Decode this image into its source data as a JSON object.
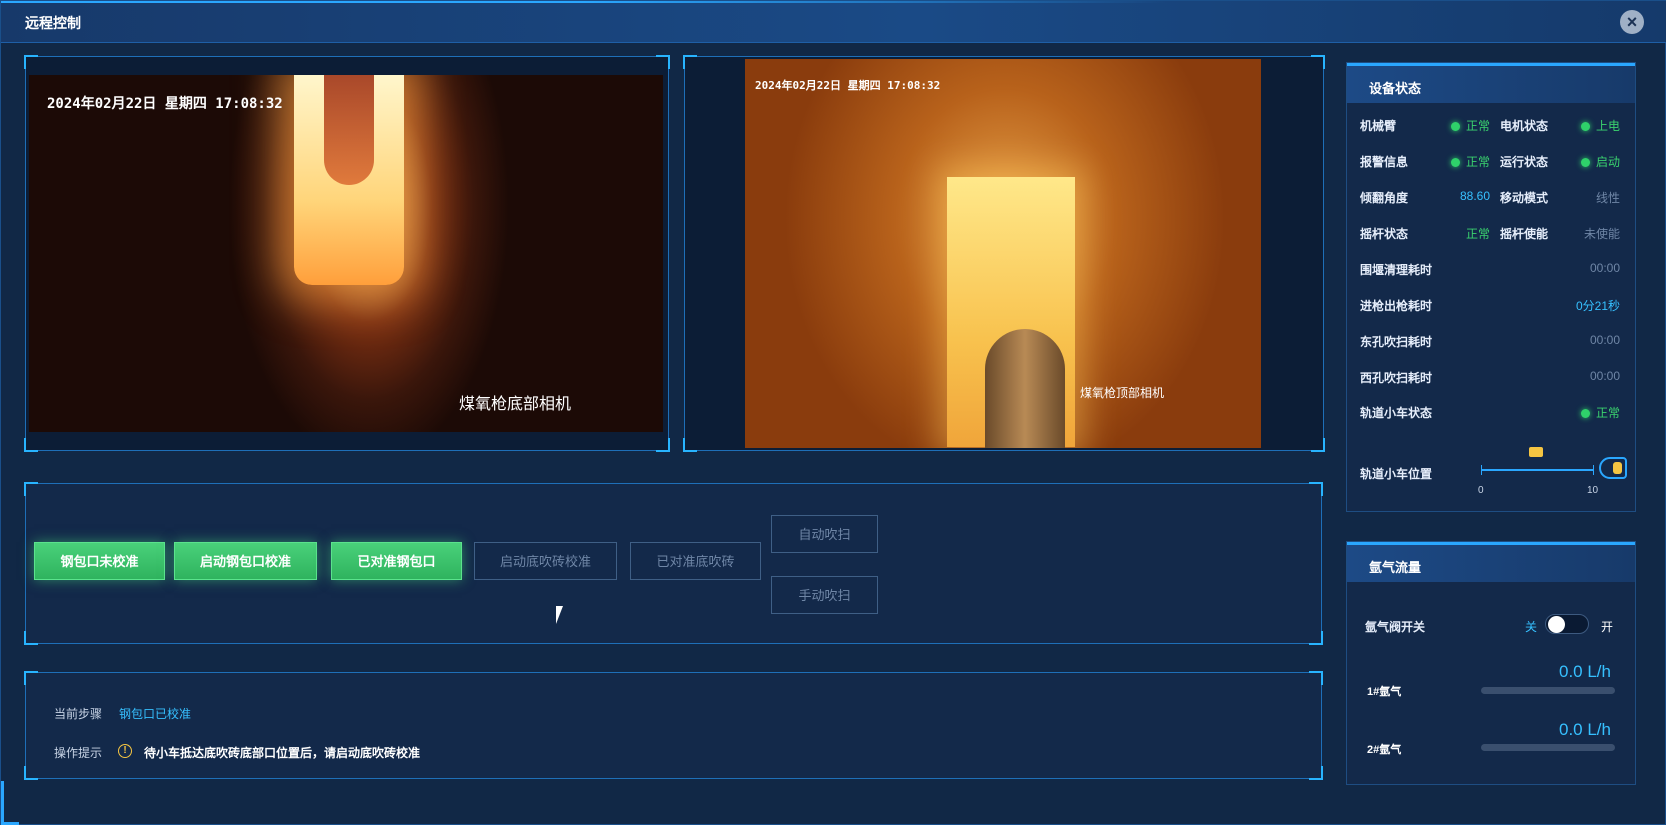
{
  "window": {
    "title": "远程控制",
    "close_icon": "close-icon"
  },
  "cameras": [
    {
      "timestamp": "2024年02月22日  星期四  17:08:32",
      "label": "煤氧枪底部相机"
    },
    {
      "timestamp": "2024年02月22日  星期四  17:08:32",
      "label": "煤氧枪顶部相机"
    }
  ],
  "controls": {
    "buttons": [
      {
        "label": "钢包口未校准",
        "state": "active"
      },
      {
        "label": "启动钢包口校准",
        "state": "active"
      },
      {
        "label": "已对准钢包口",
        "state": "active"
      },
      {
        "label": "启动底吹砖校准",
        "state": "disabled"
      },
      {
        "label": "已对准底吹砖",
        "state": "disabled"
      },
      {
        "label": "自动吹扫",
        "state": "disabled"
      },
      {
        "label": "手动吹扫",
        "state": "disabled"
      }
    ]
  },
  "info": {
    "step_label": "当前步骤",
    "step_value": "钢包口已校准",
    "tip_label": "操作提示",
    "tip_text": "待小车抵达底吹砖底部口位置后，请启动底吹砖校准"
  },
  "device_status": {
    "title": "设备状态",
    "rows": [
      {
        "left_label": "机械臂",
        "left_value": "正常",
        "left_dot": true,
        "right_label": "电机状态",
        "right_value": "上电",
        "right_dot": true
      },
      {
        "left_label": "报警信息",
        "left_value": "正常",
        "left_dot": true,
        "right_label": "运行状态",
        "right_value": "启动",
        "right_dot": true
      },
      {
        "left_label": "倾翻角度",
        "left_value": "88.60",
        "left_dot": false,
        "right_label": "移动模式",
        "right_value": "线性",
        "right_dot": false
      },
      {
        "left_label": "摇杆状态",
        "left_value": "正常",
        "left_dot": false,
        "right_label": "摇杆使能",
        "right_value": "未使能",
        "right_dot": false
      }
    ],
    "timings": [
      {
        "label": "围堰清理耗时",
        "value": "00:00"
      },
      {
        "label": "进枪出枪耗时",
        "value": "0分21秒"
      },
      {
        "label": "东孔吹扫耗时",
        "value": "00:00"
      },
      {
        "label": "西孔吹扫耗时",
        "value": "00:00"
      },
      {
        "label": "轨道小车状态",
        "value": "正常"
      }
    ],
    "track": {
      "label": "轨道小车位置",
      "min": "0",
      "max": "10",
      "position": 10
    }
  },
  "argon": {
    "title": "氩气流量",
    "valve_label": "氩气阀开关",
    "off_label": "关",
    "on_label": "开",
    "valve_on": false,
    "flows": [
      {
        "label": "1#氩气",
        "value": "0.0 L/h",
        "fraction": 0
      },
      {
        "label": "2#氩气",
        "value": "0.0 L/h",
        "fraction": 0
      }
    ]
  },
  "colors": {
    "accent": "#2aa7ff",
    "green": "#3ad26e",
    "blue_text": "#36c0ff",
    "warn": "#f5c542"
  }
}
